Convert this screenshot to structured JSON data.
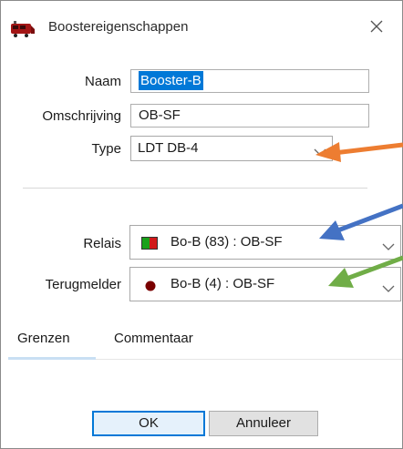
{
  "window": {
    "title": "Boostereigenschappen"
  },
  "form": {
    "name_label": "Naam",
    "name_value": "Booster-B",
    "description_label": "Omschrijving",
    "description_value": "OB-SF",
    "type_label": "Type",
    "type_value": "LDT DB-4",
    "relay_label": "Relais",
    "relay_value": "Bo-B (83) : OB-SF",
    "feedback_label": "Terugmelder",
    "feedback_value": "Bo-B (4) : OB-SF"
  },
  "tabs": [
    {
      "label": "Grenzen"
    },
    {
      "label": "Commentaar"
    }
  ],
  "buttons": {
    "ok": "OK",
    "cancel": "Annuleer"
  },
  "colors": {
    "selection": "#0078d7",
    "relay_green": "#1aa11a",
    "relay_red": "#d11a1a",
    "feedback_dot": "#7a0000",
    "annotation_orange": "#ed7d31",
    "annotation_blue": "#4472c4",
    "annotation_green": "#70ad47"
  },
  "icons": {
    "app": "train-icon",
    "close": "close-icon"
  }
}
